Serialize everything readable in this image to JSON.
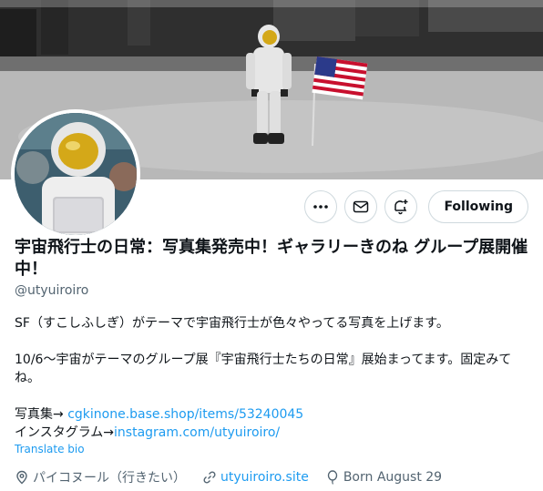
{
  "profile": {
    "display_name": "宇宙飛行士の日常：写真集発売中！ギャラリーきのね グループ展開催中！",
    "handle": "@utyuiroiro",
    "follow_button_label": "Following",
    "bio": {
      "line1": "SF（すこしふしぎ）がテーマで宇宙飛行士が色々やってる写真を上げます。",
      "line2": "10/6〜宇宙がテーマのグループ展『宇宙飛行士たちの日常』展始まってます。固定みてね。",
      "shop_prefix": "写真集→ ",
      "shop_link": "cgkinone.base.shop/items/53240045",
      "insta_prefix": "インスタグラム→",
      "insta_link": "instagram.com/utyuiroiro/"
    },
    "translate_label": "Translate bio",
    "location": "パイコヌール（行きたい）",
    "website": "utyuiroiro.site",
    "birthday": "Born August 29"
  },
  "icons": {
    "more": "more-icon",
    "message": "mail-icon",
    "notify": "bell-plus-icon",
    "location": "location-pin-icon",
    "link": "link-icon",
    "birthday": "balloon-icon"
  },
  "colors": {
    "link": "#1d9bf0",
    "muted": "#536471",
    "flag_red": "#c8102e"
  }
}
